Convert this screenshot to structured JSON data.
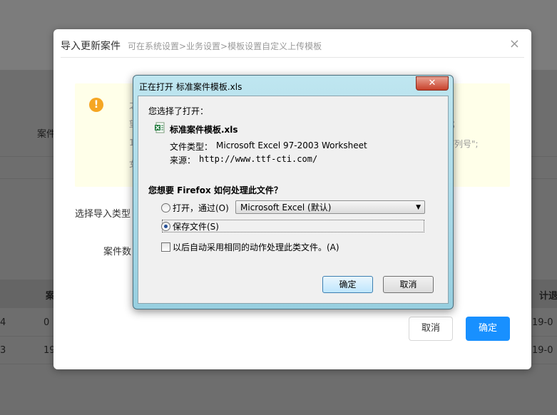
{
  "background": {
    "notice_left_label": "案件",
    "table_cells": [
      "4",
      "0",
      "3",
      "19",
      "案",
      "19-0",
      "19-0",
      "计退"
    ]
  },
  "modal": {
    "title": "导入更新案件",
    "subtitle": "可在系统设置>业务设置>模板设置自定义上传模板",
    "close_label": "×",
    "notice_icon": "!",
    "notice_fragments": [
      "之",
      "望",
      "1",
      "女",
      "；",
      "序列号\";"
    ],
    "import_type_label": "选择导入类型",
    "case_data_label": "案件数",
    "cancel_label": "取消",
    "ok_label": "确定"
  },
  "dialog": {
    "title": "正在打开 标准案件模板.xls",
    "close_label": "✕",
    "chosen_label": "您选择了打开：",
    "file_name": "标准案件模板.xls",
    "file_type_label": "文件类型：",
    "file_type_value": "Microsoft Excel 97-2003 Worksheet",
    "source_label": "来源：",
    "source_value": "http://www.ttf-cti.com/",
    "question": "您想要 Firefox 如何处理此文件？",
    "open_with_label": "打开，通过(O)",
    "open_with_app": "Microsoft Excel (默认)",
    "save_file_label": "保存文件(S)",
    "auto_label": "以后自动采用相同的动作处理此类文件。(A)",
    "ok_label": "确定",
    "cancel_label": "取消",
    "selected_option": "save"
  },
  "colors": {
    "primary": "#1890ff",
    "warning": "#f5a623",
    "notice_bg": "#ffffe9"
  }
}
